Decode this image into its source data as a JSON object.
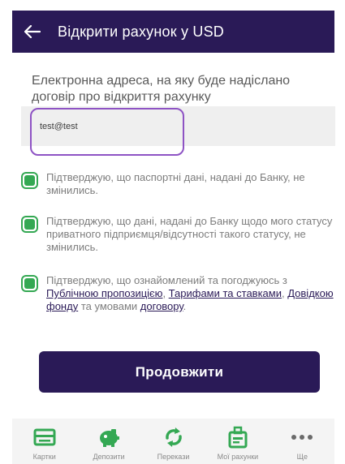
{
  "header": {
    "title": "Відкрити рахунок у USD"
  },
  "email": {
    "label": "Електронна адреса, на яку буде надіслано договір про відкриття рахунку",
    "value": "test@test"
  },
  "checks": [
    {
      "text": "Підтверджую, що паспортні дані, надані до Банку, не змінились.",
      "checked": true
    },
    {
      "text": "Підтверджую, що дані, надані до Банку щодо мого статусу приватного підприємця/відсутності такого статусу, не змінились.",
      "checked": true
    },
    {
      "checked": true,
      "prefix": "Підтверджую, що ознайомлений та погоджуюсь з ",
      "link1": "Публічною пропозицією",
      "sep1": ", ",
      "link2": "Тарифами та ставками",
      "sep2": ", ",
      "link3": "Довідкою фонду",
      "mid": " та умовами ",
      "link4": "договору",
      "suffix": "."
    }
  ],
  "continue_label": "Продовжити",
  "nav": [
    {
      "label": "Картки",
      "icon": "card-icon"
    },
    {
      "label": "Депозити",
      "icon": "piggy-bank-icon"
    },
    {
      "label": "Перекази",
      "icon": "transfer-icon"
    },
    {
      "label": "Мої рахунки",
      "icon": "accounts-icon"
    },
    {
      "label": "Ще",
      "icon": "more-icon"
    }
  ],
  "colors": {
    "primary": "#2a1a57",
    "accent_green": "#34a853",
    "focus_border": "#8e53c4"
  }
}
